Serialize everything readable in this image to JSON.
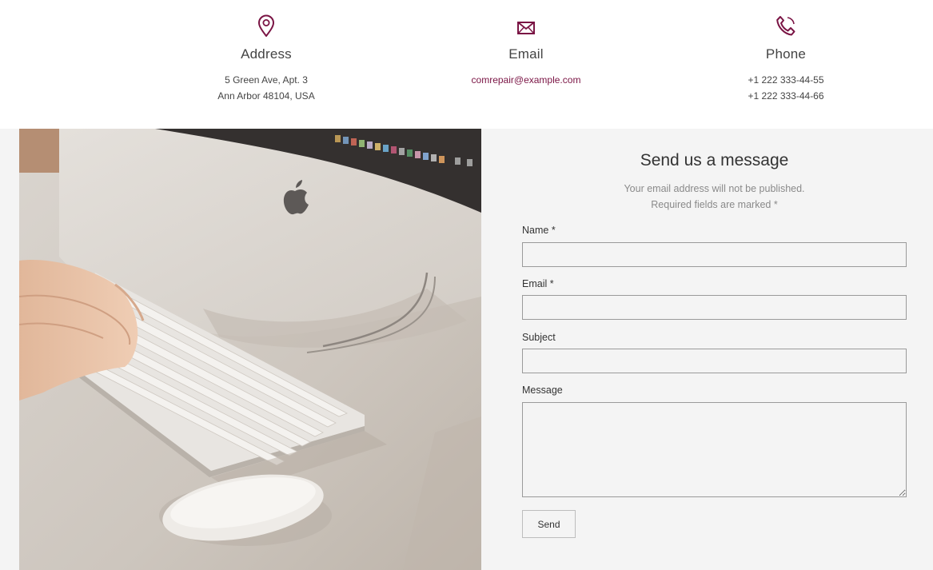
{
  "contact": {
    "address": {
      "icon": "map-pin-icon",
      "title": "Address",
      "line1": "5 Green Ave, Apt. 3",
      "line2": "Ann Arbor 48104, USA"
    },
    "email": {
      "icon": "envelope-icon",
      "title": "Email",
      "value": "comrepair@example.com"
    },
    "phone": {
      "icon": "phone-icon",
      "title": "Phone",
      "line1": "+1 222 333-44-55",
      "line2": "+1 222 333-44-66"
    },
    "accent_color": "#7a1444"
  },
  "form": {
    "title": "Send us a message",
    "note_line1": "Your email address will not be published.",
    "note_line2": "Required fields are marked *",
    "name_label": "Name *",
    "email_label": "Email *",
    "subject_label": "Subject",
    "message_label": "Message",
    "name_value": "",
    "email_value": "",
    "subject_value": "",
    "message_value": "",
    "send_label": "Send"
  }
}
